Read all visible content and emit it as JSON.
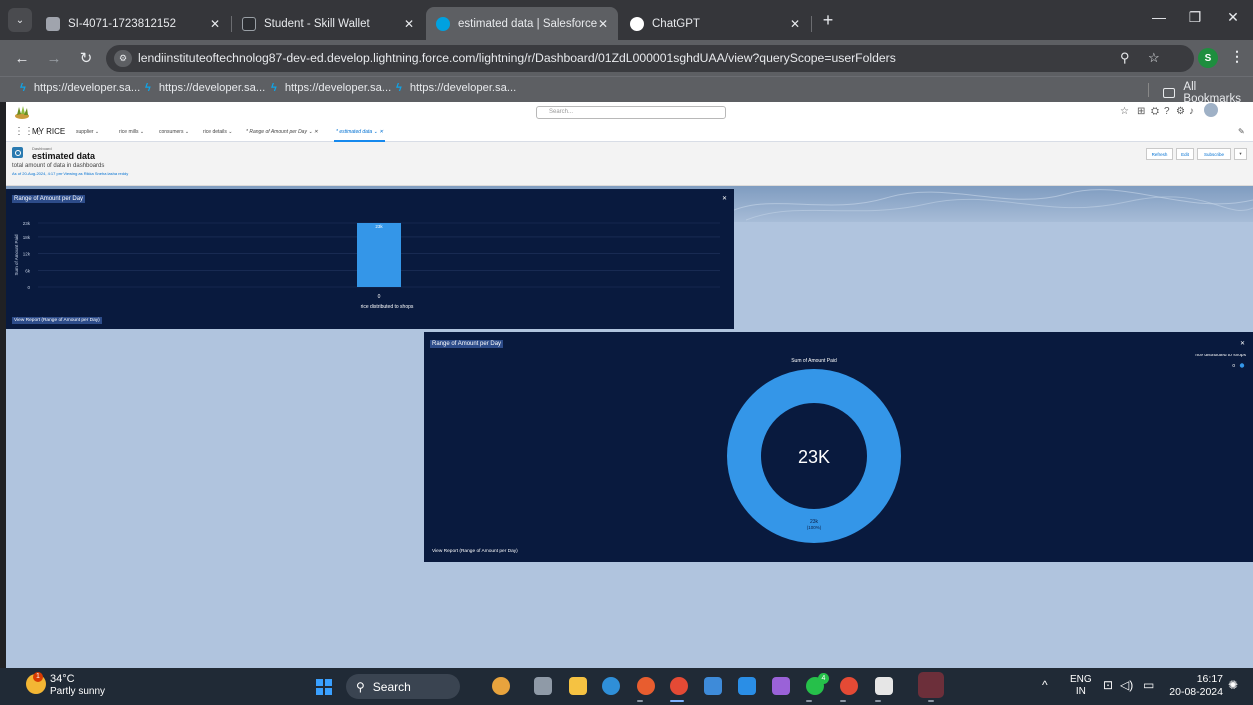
{
  "browser": {
    "tabs": [
      {
        "title": "SI-4071-1723812152",
        "active": false
      },
      {
        "title": "Student - Skill Wallet",
        "active": false
      },
      {
        "title": "estimated data | Salesforce",
        "active": true
      },
      {
        "title": "ChatGPT",
        "active": false
      }
    ],
    "url": "lendiinstituteoftechnolog87-dev-ed.develop.lightning.force.com/lightning/r/Dashboard/01ZdL000001sghdUAA/view?queryScope=userFolders",
    "profile_initial": "S",
    "bookmarks": [
      "https://developer.sa...",
      "https://developer.sa...",
      "https://developer.sa...",
      "https://developer.sa..."
    ],
    "all_bookmarks_label": "All Bookmarks"
  },
  "sf": {
    "search_placeholder": "Search...",
    "app_name": "MY RICE",
    "nav": [
      {
        "label": "supplier",
        "style": "normal"
      },
      {
        "label": "rice mills",
        "style": "normal"
      },
      {
        "label": "consumers",
        "style": "normal"
      },
      {
        "label": "rice details",
        "style": "normal"
      },
      {
        "label": "* Range of Amount per Day",
        "style": "italic"
      },
      {
        "label": "* estimated data",
        "style": "active"
      }
    ],
    "dashboard": {
      "crumb": "Dashboard",
      "title": "estimated data",
      "description": "total amount of data in dashboards",
      "as_of": "As of 20-Aug-2024, 4:17 pm·Viewing as Rikka Sneha lasha reddy",
      "buttons": {
        "refresh": "Refresh",
        "edit": "Edit",
        "subscribe": "Subscribe"
      }
    }
  },
  "widgets": {
    "bar": {
      "title": "Range of Amount per Day",
      "footer": "View Report (Range of Amount per Day)"
    },
    "donut": {
      "title": "Range of Amount per Day",
      "footer": "View Report (Range of Amount per Day)"
    }
  },
  "chart_data": [
    {
      "type": "bar",
      "title": "Range of Amount per Day",
      "xlabel": "rice distributed to shops",
      "ylabel": "Sum of Amount Paid",
      "categories": [
        "0"
      ],
      "values": [
        23000
      ],
      "data_labels": [
        "23k"
      ],
      "yticks": [
        "0",
        "6k",
        "12k",
        "18k",
        "23k"
      ],
      "ylim": [
        0,
        23000
      ],
      "grid": true
    },
    {
      "type": "pie",
      "donut": true,
      "title": "Range of Amount per Day",
      "subtitle": "Sum of Amount Paid",
      "legend_title": "rice distributed to shops",
      "legend_position": "top-right",
      "categories": [
        "0"
      ],
      "values": [
        23000
      ],
      "center_label": "23K",
      "slice_label": "23k",
      "slice_percent": "(100%)",
      "color": "#3496e8"
    }
  ],
  "taskbar": {
    "weather_temp": "34°C",
    "weather_condition": "Partly sunny",
    "weather_badge": "1",
    "search_label": "Search",
    "whatsapp_badge": "4",
    "lang_top": "ENG",
    "lang_bottom": "IN",
    "time": "16:17",
    "date": "20-08-2024"
  },
  "colors": {
    "page_bg": "#b0c4de",
    "widget_bg": "#091a3e",
    "accent": "#3496e8",
    "sf_blue": "#0070d2"
  }
}
